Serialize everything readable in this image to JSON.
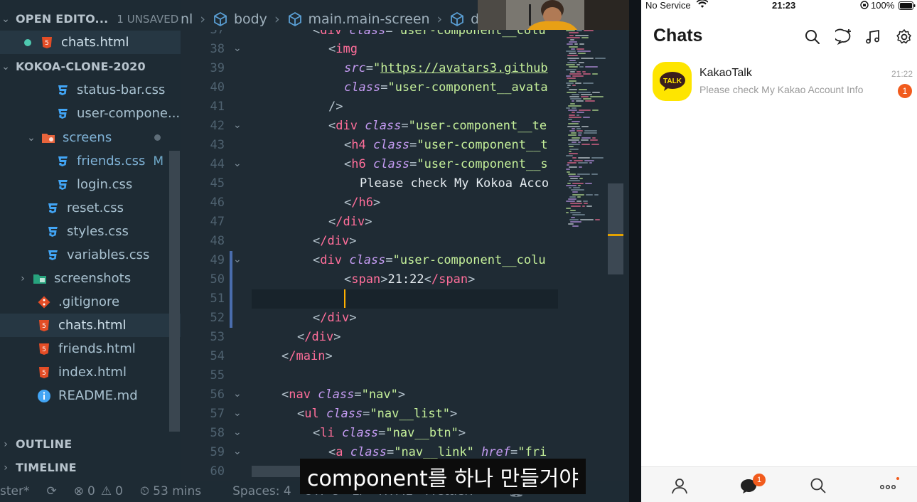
{
  "explorer": {
    "open_editors": {
      "title": "OPEN EDITO...",
      "unsaved": "1 UNSAVED"
    },
    "open_files": [
      {
        "name": "chats.html"
      }
    ],
    "project": {
      "title": "KOKOA-CLONE-2020"
    },
    "tree": [
      {
        "name": "status-bar.css"
      },
      {
        "name": "user-compone..."
      },
      {
        "name": "screens"
      },
      {
        "name": "friends.css",
        "badge": "M"
      },
      {
        "name": "login.css"
      },
      {
        "name": "reset.css"
      },
      {
        "name": "styles.css"
      },
      {
        "name": "variables.css"
      },
      {
        "name": "screenshots"
      },
      {
        "name": ".gitignore"
      },
      {
        "name": "chats.html"
      },
      {
        "name": "friends.html"
      },
      {
        "name": "index.html"
      },
      {
        "name": "README.md"
      }
    ],
    "outline": "OUTLINE",
    "timeline": "TIMELINE"
  },
  "editor": {
    "breadcrumb": [
      "nl",
      "body",
      "main.main-screen",
      "div.u"
    ],
    "line_numbers": [
      "37",
      "38",
      "39",
      "40",
      "41",
      "42",
      "43",
      "44",
      "45",
      "46",
      "47",
      "48",
      "49",
      "50",
      "51",
      "52",
      "53",
      "54",
      "55",
      "56",
      "57",
      "58",
      "59",
      "60"
    ],
    "code": {
      "l37": {
        "tag": "div",
        "attr": "class",
        "val": "user-component__colu"
      },
      "l38": {
        "tag": "img"
      },
      "l39": {
        "attr": "src",
        "val": "https://avatars3.github"
      },
      "l40": {
        "attr": "class",
        "val": "user-component__avata"
      },
      "l41": {
        "close": "/>"
      },
      "l42": {
        "tag": "div",
        "attr": "class",
        "val": "user-component__te"
      },
      "l43": {
        "tag": "h4",
        "attr": "class",
        "val": "user-component__t"
      },
      "l44": {
        "tag": "h6",
        "attr": "class",
        "val": "user-component__s"
      },
      "l45": {
        "text": "Please check My Kokoa Acco"
      },
      "l46": {
        "tag": "/h6"
      },
      "l47": {
        "tag": "/div"
      },
      "l48": {
        "tag": "/div"
      },
      "l49": {
        "tag": "div",
        "attr": "class",
        "val": "user-component__colu"
      },
      "l50": {
        "tag": "span",
        "text": "21:22",
        "end": "/span"
      },
      "l52": {
        "tag": "/div"
      },
      "l53": {
        "tag": "/div"
      },
      "l54": {
        "tag": "/main"
      },
      "l56": {
        "tag": "nav",
        "attr": "class",
        "val": "nav"
      },
      "l57": {
        "tag": "ul",
        "attr": "class",
        "val": "nav__list"
      },
      "l58": {
        "tag": "li",
        "attr": "class",
        "val": "nav__btn"
      },
      "l59": {
        "tag": "a",
        "attr": "class",
        "val": "nav__link",
        "attr2": "href",
        "val2": "fri"
      }
    },
    "subtitle": "component를 하나 만들거야"
  },
  "statusbar": {
    "branch": "ster*",
    "errors": "0",
    "warnings": "0",
    "time": "53 mins",
    "spaces": "Spaces: 4",
    "encoding": "UTF-8",
    "eol": "LF",
    "language": "HTML",
    "formatter": "Prettier: ✓"
  },
  "phone": {
    "status": {
      "carrier": "No Service",
      "time": "21:23",
      "battery": "100%"
    },
    "title": "Chats",
    "chat": {
      "name": "KakaoTalk",
      "message": "Please check My Kakao Account Info",
      "time": "21:22",
      "unread": "1",
      "avatar_text": "TALK"
    },
    "tab_badge": "1",
    "icons": [
      "search-icon",
      "new-chat-icon",
      "music-icon",
      "settings-icon"
    ],
    "tabs": [
      "friends-tab-icon",
      "chats-tab-icon",
      "search-tab-icon",
      "more-tab-icon"
    ],
    "colors": {
      "kakao_yellow": "#fee500",
      "badge": "#f15b1d"
    }
  }
}
